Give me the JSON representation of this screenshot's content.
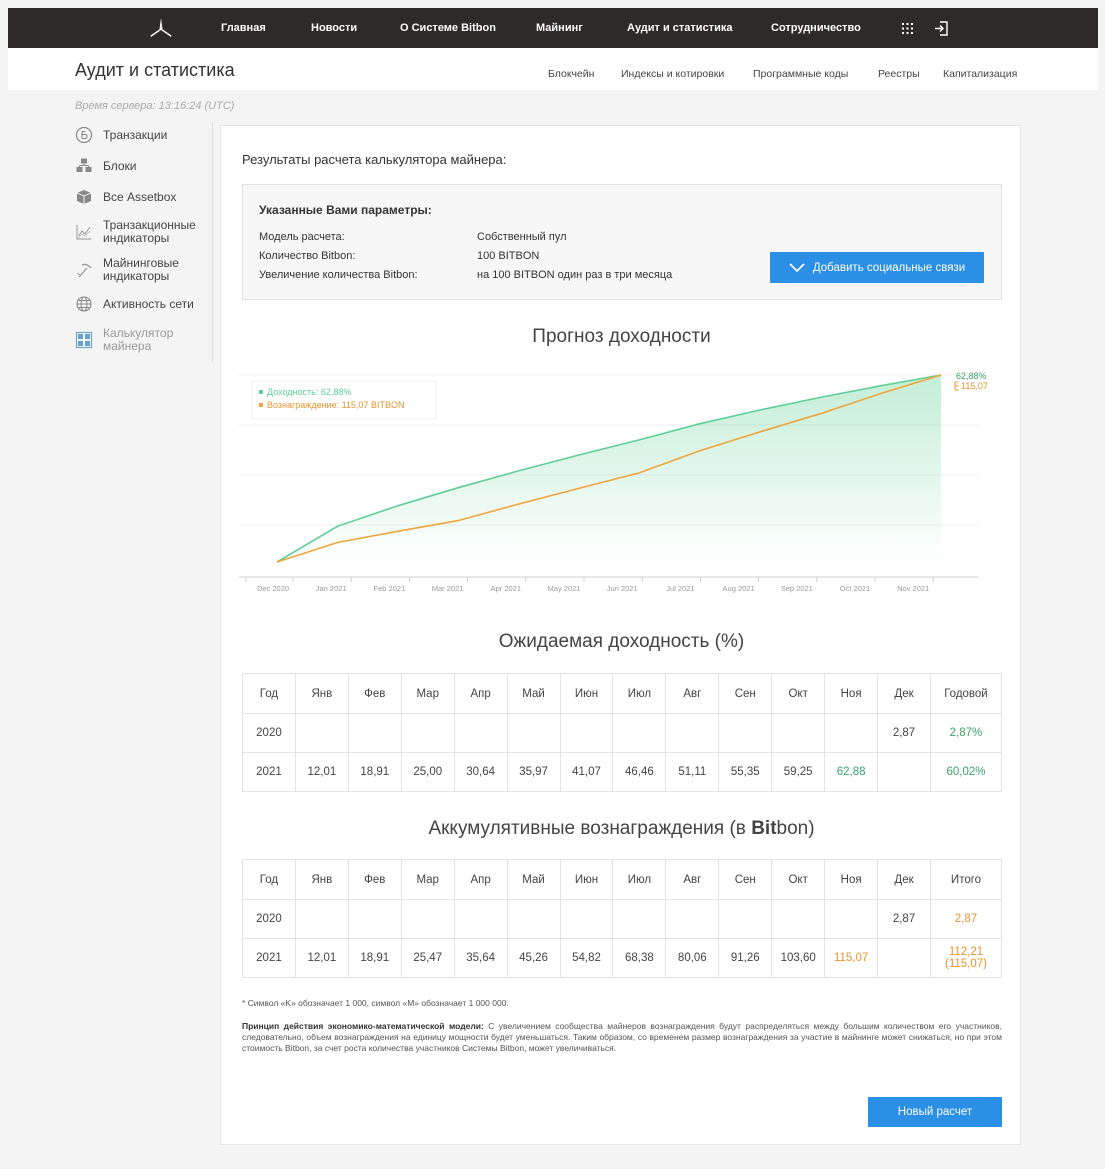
{
  "topnav": {
    "items": [
      "Главная",
      "Новости",
      "О Системе Bitbon",
      "Майнинг",
      "Аудит и статистика",
      "Сотрудничество"
    ],
    "apps_icon": "grid-icon",
    "login_icon": "login-icon"
  },
  "subheader": {
    "title": "Аудит и статистика",
    "links": [
      "Блокчейн",
      "Индексы и котировки",
      "Программные коды",
      "Реестры",
      "Капитализация"
    ]
  },
  "server_time": "Время сервера: 13:16:24 (UTC)",
  "sidebar": {
    "items": [
      {
        "label": "Транзакции",
        "icon": "coin-icon"
      },
      {
        "label": "Блоки",
        "icon": "blocks-icon"
      },
      {
        "label": "Все Assetbox",
        "icon": "box-icon"
      },
      {
        "label": "Транзакционные индикаторы",
        "line1": "Транзакционные",
        "line2": "индикаторы",
        "icon": "chart-icon"
      },
      {
        "label": "Майнинговые индикаторы",
        "line1": "Майнинговые",
        "line2": "индикаторы",
        "icon": "pick-icon"
      },
      {
        "label": "Активность сети",
        "icon": "globe-icon"
      },
      {
        "label": "Калькулятор майнера",
        "line1": "Калькулятор",
        "line2": "майнера",
        "icon": "calculator-icon"
      }
    ]
  },
  "results": {
    "title": "Результаты расчета калькулятора майнера:",
    "params_heading": "Указанные Вами параметры:",
    "params": [
      {
        "label": "Модель расчета:",
        "value": "Собственный пул"
      },
      {
        "label": "Количество Bitbon:",
        "value": "100 BITBON"
      },
      {
        "label": "Увеличение количества Bitbon:",
        "value": "на 100 BITBON один раз в три месяца"
      }
    ],
    "social_button": "Добавить социальные связи"
  },
  "chart_data": {
    "type": "line",
    "title": "Прогноз доходности",
    "x": [
      "Dec 2020",
      "Jan 2021",
      "Feb 2021",
      "Mar 2021",
      "Apr 2021",
      "May 2021",
      "Jun 2021",
      "Jul 2021",
      "Aug 2021",
      "Sep 2021",
      "Oct 2021",
      "Nov 2021"
    ],
    "series": [
      {
        "name": "Доходность: 62,88%",
        "color": "#5fcf97",
        "values": [
          0,
          12.01,
          18.91,
          25.0,
          30.64,
          35.97,
          41.07,
          46.46,
          51.11,
          55.35,
          59.25,
          62.88
        ]
      },
      {
        "name": "Вознаграждение: 115,07 BITBON",
        "color": "#f0a53c",
        "values": [
          0,
          12.01,
          18.91,
          25.47,
          35.64,
          45.26,
          54.82,
          68.38,
          80.06,
          91.26,
          103.6,
          115.07
        ]
      }
    ],
    "end_labels": [
      "62,88%",
      "115,07"
    ],
    "legend_position": "top-left",
    "grid": true
  },
  "expected": {
    "title": "Ожидаемая доходность (%)",
    "headers": [
      "Год",
      "Янв",
      "Фев",
      "Мар",
      "Апр",
      "Май",
      "Июн",
      "Июл",
      "Авг",
      "Сен",
      "Окт",
      "Ноя",
      "Дек",
      "Годовой"
    ],
    "rows": [
      [
        "2020",
        "",
        "",
        "",
        "",
        "",
        "",
        "",
        "",
        "",
        "",
        "",
        "2,87",
        "2,87%"
      ],
      [
        "2021",
        "12,01",
        "18,91",
        "25,00",
        "30,64",
        "35,97",
        "41,07",
        "46,46",
        "51,11",
        "55,35",
        "59,25",
        "62,88",
        "",
        "60,02%"
      ]
    ]
  },
  "cumulative": {
    "title_pre": "Аккумулятивные вознаграждения (в ",
    "title_bold": "Bit",
    "title_post": "bon)",
    "headers": [
      "Год",
      "Янв",
      "Фев",
      "Мар",
      "Апр",
      "Май",
      "Июн",
      "Июл",
      "Авг",
      "Сен",
      "Окт",
      "Ноя",
      "Дек",
      "Итого"
    ],
    "rows": [
      [
        "2020",
        "",
        "",
        "",
        "",
        "",
        "",
        "",
        "",
        "",
        "",
        "",
        "2,87",
        "2,87"
      ],
      [
        "2021",
        "12,01",
        "18,91",
        "25,47",
        "35,64",
        "45,26",
        "54,82",
        "68,38",
        "80,06",
        "91,26",
        "103,60",
        "115,07",
        "",
        "112,21"
      ]
    ],
    "total_extra": "(115,07)"
  },
  "footnote": "* Символ «K» обозначает 1 000, символ «M» обозначает 1 000 000.",
  "principle": {
    "label": "Принцип действия экономико-математической модели:",
    "text": " С увеличением сообщества майнеров вознаграждения будут распределяться между большим количеством его участников, следовательно, объем вознаграждения на единицу мощности будет уменьшаться. Таким образом, со временем размер вознаграждения за участие в майнинге может снижаться, но при этом стоимость Bitbon, за счет роста количества участников Системы Bitbon, может увеличиваться."
  },
  "new_calc_button": "Новый расчет"
}
